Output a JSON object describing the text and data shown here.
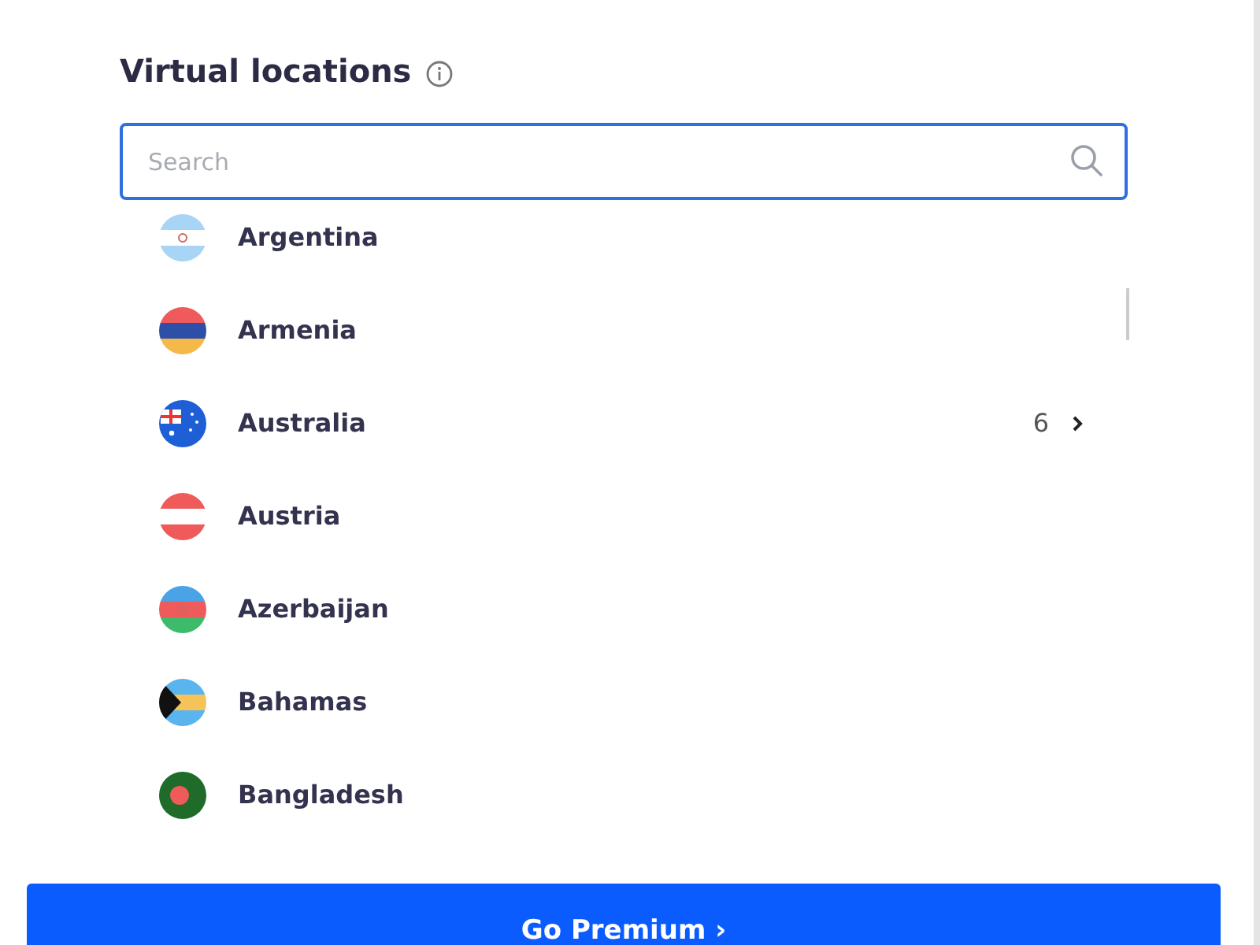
{
  "title": "Virtual locations",
  "search": {
    "placeholder": "Search"
  },
  "locations": [
    {
      "name": "Argentina"
    },
    {
      "name": "Armenia"
    },
    {
      "name": "Australia",
      "count": "6"
    },
    {
      "name": "Austria"
    },
    {
      "name": "Azerbaijan"
    },
    {
      "name": "Bahamas"
    },
    {
      "name": "Bangladesh"
    }
  ],
  "cta": {
    "label": "Go Premium ›"
  }
}
